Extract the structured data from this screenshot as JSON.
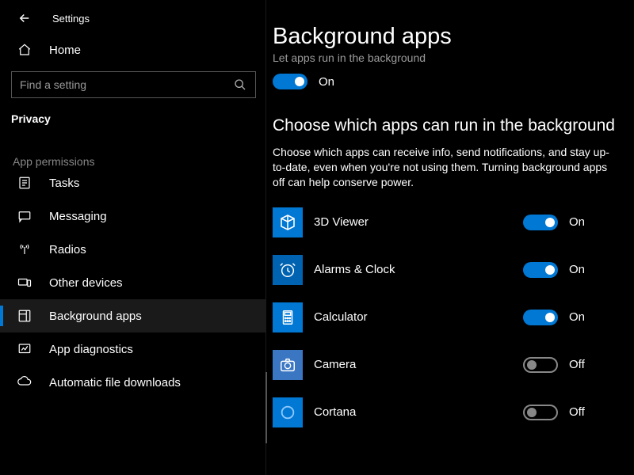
{
  "topbar": {
    "title": "Settings"
  },
  "home": {
    "label": "Home"
  },
  "search": {
    "placeholder": "Find a setting"
  },
  "category": "Privacy",
  "section_label": "App permissions",
  "nav": [
    {
      "label": "Tasks"
    },
    {
      "label": "Messaging"
    },
    {
      "label": "Radios"
    },
    {
      "label": "Other devices"
    },
    {
      "label": "Background apps",
      "active": true
    },
    {
      "label": "App diagnostics"
    },
    {
      "label": "Automatic file downloads"
    }
  ],
  "main": {
    "title": "Background apps",
    "master_sub": "Let apps run in the background",
    "master_state": "On",
    "subheading": "Choose which apps can run in the background",
    "desc": "Choose which apps can receive info, send notifications, and stay up-to-date, even when you're not using them. Turning background apps off can help conserve power.",
    "on_label": "On",
    "off_label": "Off",
    "apps": [
      {
        "name": "3D Viewer",
        "state": "On"
      },
      {
        "name": "Alarms & Clock",
        "state": "On"
      },
      {
        "name": "Calculator",
        "state": "On"
      },
      {
        "name": "Camera",
        "state": "Off"
      },
      {
        "name": "Cortana",
        "state": "Off"
      }
    ]
  }
}
